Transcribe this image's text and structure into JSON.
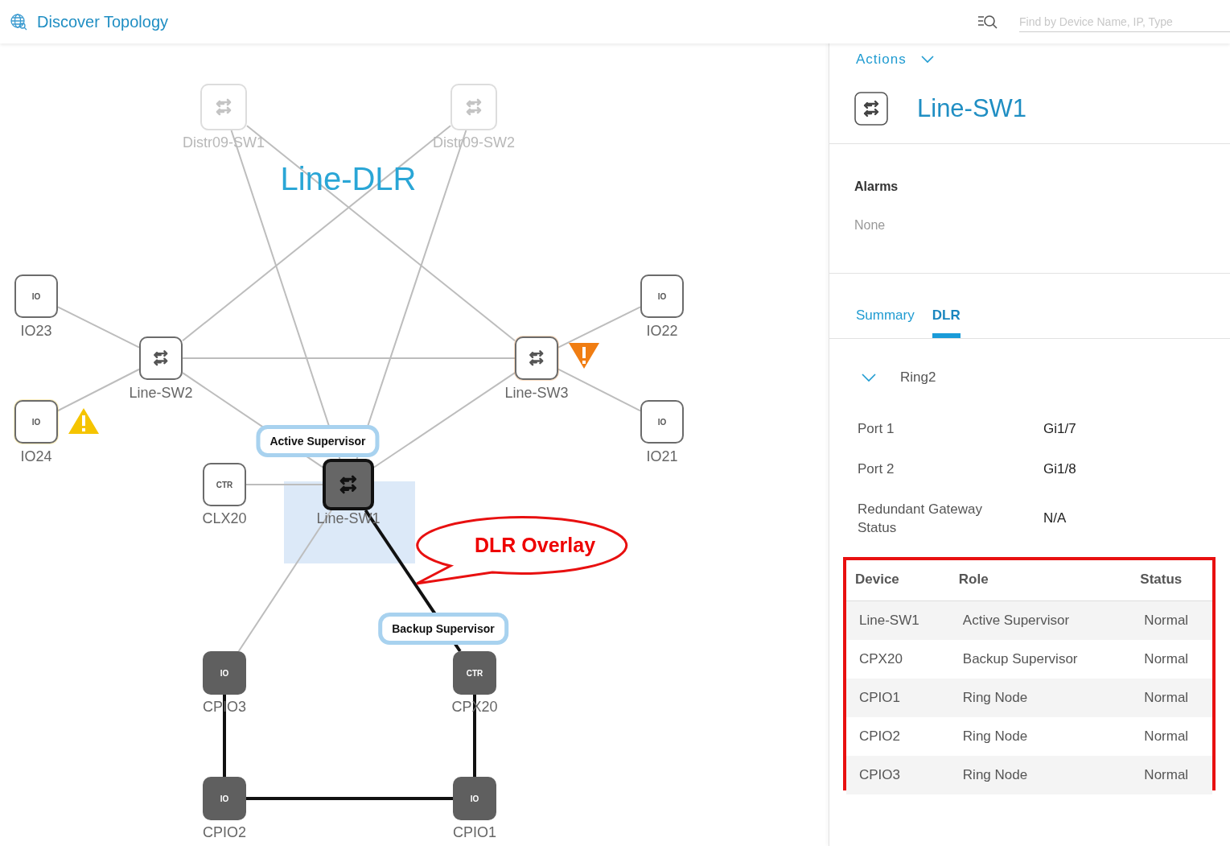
{
  "header": {
    "title": "Discover Topology",
    "search": {
      "placeholder": "Find by Device Name, IP, Type"
    }
  },
  "topology": {
    "title": "Line-DLR",
    "nodes": [
      {
        "label": "Distr09-SW1",
        "kind": "switch",
        "faded": true,
        "selected": false,
        "in_ring": false,
        "warning": false,
        "critical": false
      },
      {
        "label": "Distr09-SW2",
        "kind": "switch",
        "faded": true,
        "selected": false,
        "in_ring": false,
        "warning": false,
        "critical": false
      },
      {
        "label": "IO23",
        "kind": "io",
        "text": "IO",
        "faded": false,
        "selected": false,
        "in_ring": false,
        "warning": false,
        "critical": false
      },
      {
        "label": "IO24",
        "kind": "io",
        "text": "IO",
        "faded": false,
        "selected": false,
        "in_ring": false,
        "warning": true,
        "critical": false
      },
      {
        "label": "Line-SW2",
        "kind": "switch",
        "faded": false,
        "selected": false,
        "in_ring": false,
        "warning": false,
        "critical": false
      },
      {
        "label": "Line-SW3",
        "kind": "switch",
        "faded": false,
        "selected": false,
        "in_ring": false,
        "warning": false,
        "critical": true
      },
      {
        "label": "IO22",
        "kind": "io",
        "text": "IO",
        "faded": false,
        "selected": false,
        "in_ring": false,
        "warning": false,
        "critical": false
      },
      {
        "label": "IO21",
        "kind": "io",
        "text": "IO",
        "faded": false,
        "selected": false,
        "in_ring": false,
        "warning": false,
        "critical": false
      },
      {
        "label": "CLX20",
        "kind": "io",
        "text": "CTR",
        "faded": false,
        "selected": false,
        "in_ring": false,
        "warning": false,
        "critical": false
      },
      {
        "label": "Line-SW1",
        "kind": "switch",
        "badge": "Active Supervisor",
        "faded": false,
        "selected": true,
        "in_ring": false,
        "warning": false,
        "critical": false
      },
      {
        "label": "CPIO3",
        "kind": "io",
        "text": "IO",
        "faded": false,
        "selected": false,
        "in_ring": true,
        "warning": false,
        "critical": false
      },
      {
        "label": "CPX20",
        "kind": "io",
        "text": "CTR",
        "badge": "Backup Supervisor",
        "faded": false,
        "selected": false,
        "in_ring": true,
        "warning": false,
        "critical": false
      },
      {
        "label": "CPIO2",
        "kind": "io",
        "text": "IO",
        "faded": false,
        "selected": false,
        "in_ring": true,
        "warning": false,
        "critical": false
      },
      {
        "label": "CPIO1",
        "kind": "io",
        "text": "IO",
        "faded": false,
        "selected": false,
        "in_ring": true,
        "warning": false,
        "critical": false
      }
    ],
    "links": [
      {
        "in_ring": false
      },
      {
        "in_ring": false
      },
      {
        "in_ring": false
      },
      {
        "in_ring": false
      },
      {
        "in_ring": false
      },
      {
        "in_ring": false
      },
      {
        "in_ring": false
      },
      {
        "in_ring": false
      },
      {
        "in_ring": false
      },
      {
        "in_ring": false
      },
      {
        "in_ring": false
      },
      {
        "in_ring": false
      },
      {
        "in_ring": false
      },
      {
        "in_ring": true
      },
      {
        "in_ring": true
      },
      {
        "in_ring": true
      },
      {
        "in_ring": true
      }
    ],
    "callout": {
      "text": "DLR Overlay"
    }
  },
  "panel": {
    "actions": "Actions",
    "device": "Line-SW1",
    "alarms": {
      "title": "Alarms",
      "value": "None"
    },
    "tabs": [
      {
        "label": "Summary",
        "selected": false
      },
      {
        "label": "DLR",
        "selected": true
      }
    ],
    "ring": {
      "label": "Ring2",
      "expanded": true
    },
    "details": [
      {
        "label": "Port 1",
        "value": "Gi1/7"
      },
      {
        "label": "Port 2",
        "value": "Gi1/8"
      },
      {
        "label": "Redundant Gateway Status",
        "value": "N/A"
      }
    ],
    "table": {
      "columns": [
        "Device",
        "Role",
        "Status"
      ],
      "rows": [
        [
          "Line-SW1",
          "Active Supervisor",
          "Normal"
        ],
        [
          "CPX20",
          "Backup Supervisor",
          "Normal"
        ],
        [
          "CPIO1",
          "Ring Node",
          "Normal"
        ],
        [
          "CPIO2",
          "Ring Node",
          "Normal"
        ],
        [
          "CPIO3",
          "Ring Node",
          "Normal"
        ]
      ]
    }
  }
}
